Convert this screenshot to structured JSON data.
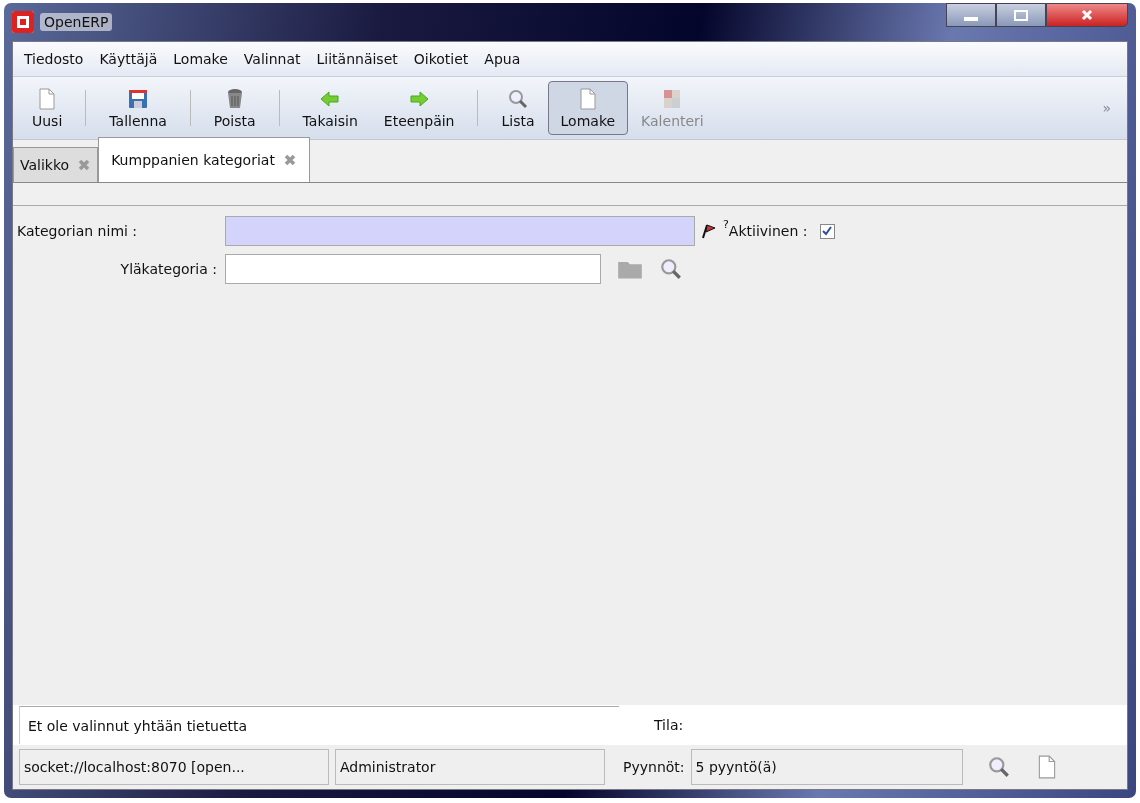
{
  "window": {
    "title": "OpenERP"
  },
  "menu": [
    "Tiedosto",
    "Käyttäjä",
    "Lomake",
    "Valinnat",
    "Liitännäiset",
    "Oikotiet",
    "Apua"
  ],
  "toolbar": [
    {
      "label": "Uusi",
      "selected": false,
      "disabled": false
    },
    {
      "kind": "separator"
    },
    {
      "label": "Tallenna",
      "selected": false,
      "disabled": false
    },
    {
      "kind": "separator"
    },
    {
      "label": "Poista",
      "selected": false,
      "disabled": false
    },
    {
      "kind": "separator"
    },
    {
      "label": "Takaisin",
      "selected": false,
      "disabled": false
    },
    {
      "label": "Eteenpäin",
      "selected": false,
      "disabled": false
    },
    {
      "kind": "separator"
    },
    {
      "label": "Lista",
      "selected": false,
      "disabled": false
    },
    {
      "label": "Lomake",
      "selected": true,
      "disabled": false
    },
    {
      "label": "Kalenteri",
      "selected": false,
      "disabled": true
    }
  ],
  "toolbar_more": "»",
  "tabs": [
    {
      "label": "Valikko",
      "selected": false
    },
    {
      "label": "Kumppanien kategoriat",
      "selected": true
    }
  ],
  "form": {
    "name": {
      "label": "Kategorian nimi :",
      "required": true
    },
    "active": {
      "label": "Aktiivinen :",
      "help_mark": "?",
      "checked": true
    },
    "parent": {
      "label": "Yläkategoria :"
    }
  },
  "info": {
    "message": "Et ole valinnut yhtään tietuetta",
    "state_label": "Tila:"
  },
  "status_bar": {
    "server": "socket://localhost:8070 [open...",
    "user": "Administrator",
    "requests_label": "Pyynnöt:",
    "requests": "5 pyyntö(ä)"
  }
}
